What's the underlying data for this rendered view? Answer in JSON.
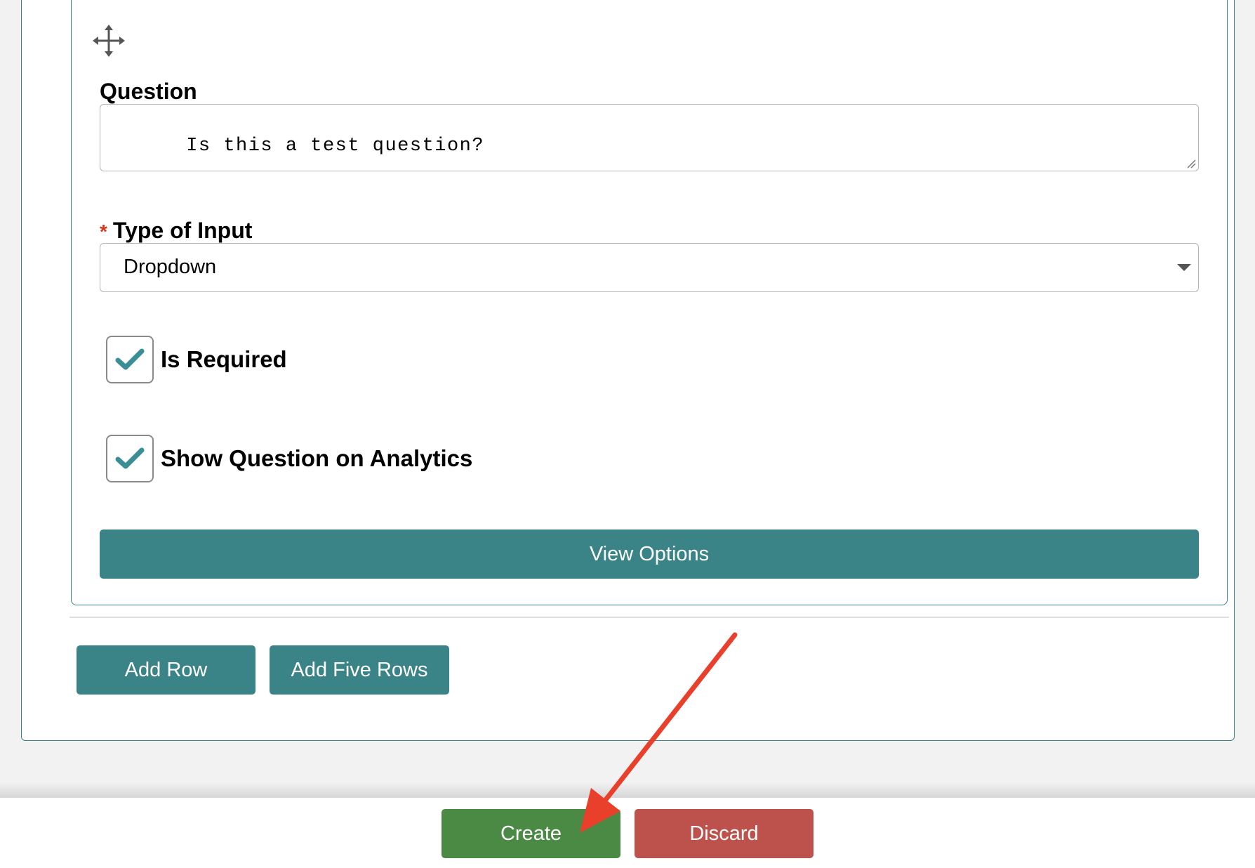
{
  "question_card": {
    "drag_icon": "move-arrows-icon",
    "question_label": "Question",
    "question_value": "Is this a test question?",
    "type_label_required_marker": "*",
    "type_label": "Type of Input",
    "type_selected": "Dropdown",
    "checkboxes": [
      {
        "label": "Is Required",
        "checked": true
      },
      {
        "label": "Show Question on Analytics",
        "checked": true
      }
    ],
    "view_options_label": "View Options"
  },
  "row_actions": {
    "add_row_label": "Add Row",
    "add_five_rows_label": "Add Five Rows"
  },
  "footer": {
    "create_label": "Create",
    "discard_label": "Discard"
  },
  "colors": {
    "teal": "#3a8487",
    "green": "#4a8a45",
    "red": "#bd524c",
    "annotation_arrow": "#e8402a",
    "check": "#3a8f96"
  }
}
